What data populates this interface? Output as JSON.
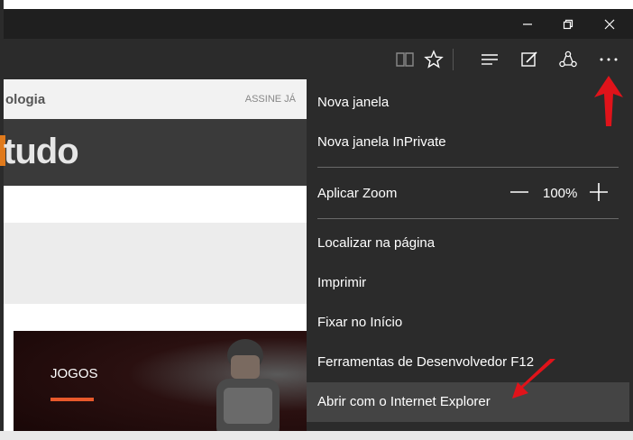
{
  "window": {
    "minimize_label": "—",
    "restore_label": "❐",
    "close_label": "✕"
  },
  "page": {
    "nav_partial": "ologia",
    "subscribe": "ASSINE JÁ",
    "logo_text": "tudo",
    "card_label": "JOGOS"
  },
  "menu": {
    "new_window": "Nova janela",
    "new_private_window": "Nova janela InPrivate",
    "zoom_label": "Aplicar Zoom",
    "zoom_value": "100%",
    "find_in_page": "Localizar na página",
    "print": "Imprimir",
    "pin_to_start": "Fixar no Início",
    "dev_tools": "Ferramentas de Desenvolvedor F12",
    "open_with_ie": "Abrir com o Internet Explorer"
  },
  "colors": {
    "accent": "#e07a1c",
    "arrow": "#e0131a"
  }
}
